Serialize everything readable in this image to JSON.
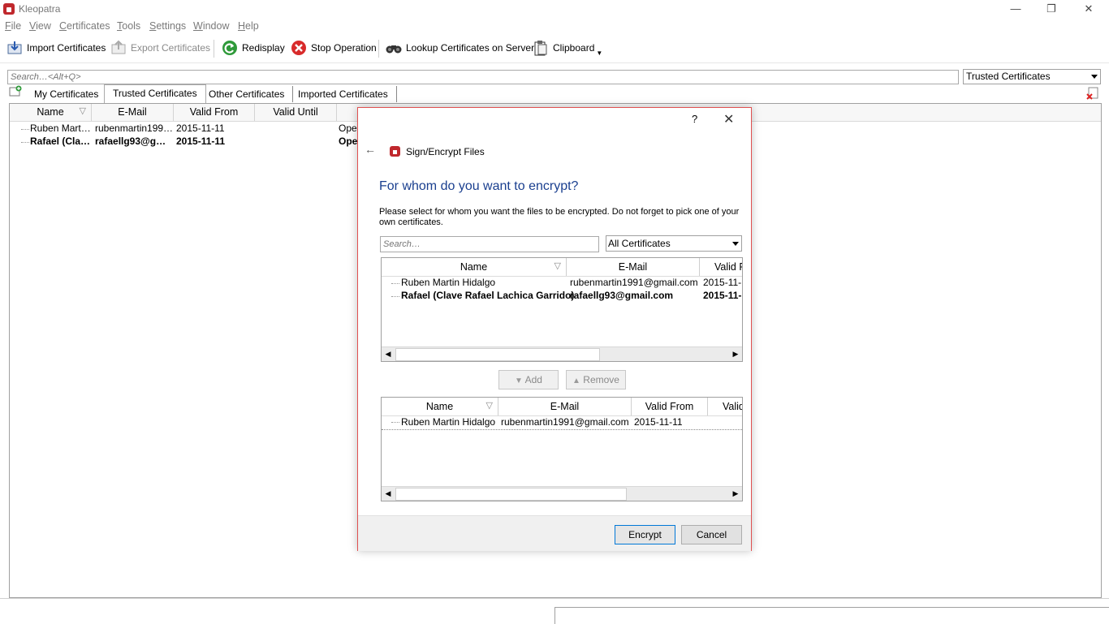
{
  "window": {
    "title": "Kleopatra",
    "minimize": "—",
    "restore": "❐",
    "close": "✕"
  },
  "menu": [
    {
      "u": "F",
      "rest": "ile"
    },
    {
      "u": "V",
      "rest": "iew"
    },
    {
      "u": "C",
      "rest": "ertificates"
    },
    {
      "u": "T",
      "rest": "ools"
    },
    {
      "u": "S",
      "rest": "ettings"
    },
    {
      "u": "W",
      "rest": "indow"
    },
    {
      "u": "H",
      "rest": "elp"
    }
  ],
  "toolbar": {
    "import": "Import Certificates",
    "export": "Export Certificates",
    "redisplay": "Redisplay",
    "stop": "Stop Operation",
    "lookup": "Lookup Certificates on Server",
    "clipboard": "Clipboard"
  },
  "search": {
    "placeholder": "Search…<Alt+Q>",
    "filter_value": "Trusted Certificates"
  },
  "tabs": [
    "My Certificates",
    "Trusted Certificates",
    "Other Certificates",
    "Imported Certificates"
  ],
  "main_list": {
    "columns": [
      "Name",
      "E-Mail",
      "Valid From",
      "Valid Until"
    ],
    "rows": [
      {
        "name": "Ruben Mart…",
        "email": "rubenmartin199…",
        "valid_from": "2015-11-11",
        "extra": "Oper",
        "bold": false
      },
      {
        "name": "Rafael (Cla…",
        "email": "rafaellg93@g…",
        "valid_from": "2015-11-11",
        "extra": "Ope",
        "bold": true
      }
    ]
  },
  "dialog": {
    "help": "?",
    "close": "✕",
    "back": "←",
    "wizard_title": "Sign/Encrypt Files",
    "heading": "For whom do you want to encrypt?",
    "description": "Please select for whom you want the files to be encrypted. Do not forget to pick one of your own certificates.",
    "search_placeholder": "Search…",
    "filter_value": "All Certificates",
    "available": {
      "columns": [
        "Name",
        "E-Mail",
        "Valid F"
      ],
      "rows": [
        {
          "name": "Ruben Martin Hidalgo",
          "email": "rubenmartin1991@gmail.com",
          "valid_from": "2015-11-",
          "bold": false
        },
        {
          "name": "Rafael (Clave Rafael Lachica Garrido)",
          "email": "rafaellg93@gmail.com",
          "valid_from": "2015-11-",
          "bold": true
        }
      ]
    },
    "add_label": "Add",
    "remove_label": "Remove",
    "selected": {
      "columns": [
        "Name",
        "E-Mail",
        "Valid From",
        "Valid"
      ],
      "rows": [
        {
          "name": "Ruben Martin Hidalgo",
          "email": "rubenmartin1991@gmail.com",
          "valid_from": "2015-11-11"
        }
      ]
    },
    "encrypt_label": "Encrypt",
    "cancel_label": "Cancel"
  }
}
